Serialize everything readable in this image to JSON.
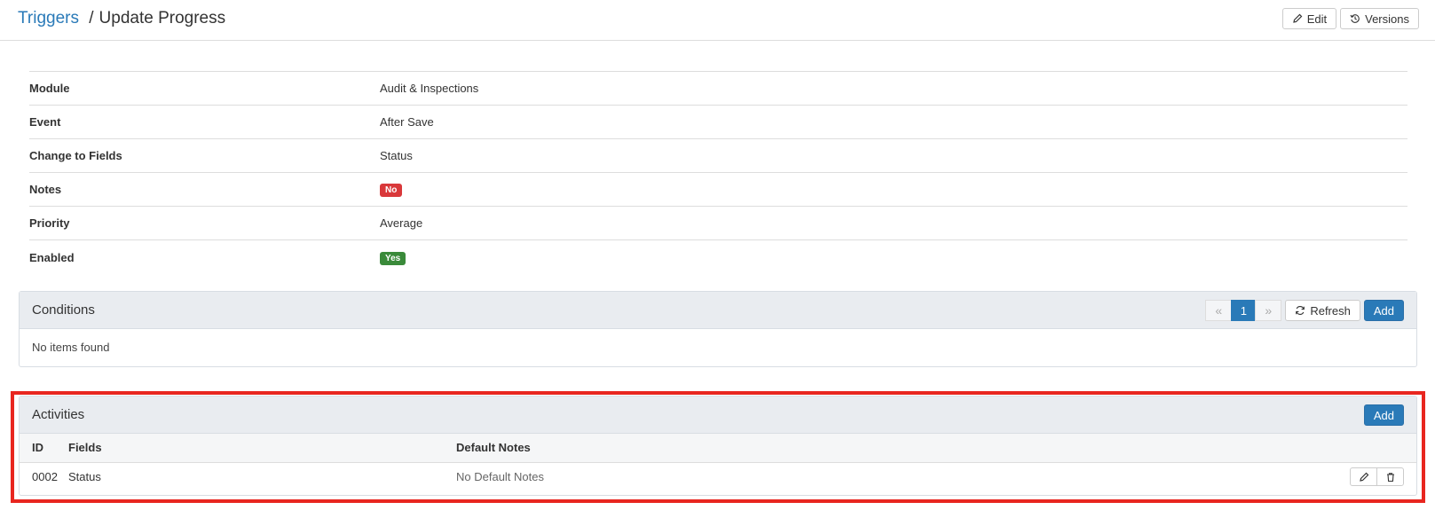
{
  "header": {
    "breadcrumb_link": "Triggers",
    "breadcrumb_separator": "/",
    "title": "Update Progress",
    "edit_label": "Edit",
    "versions_label": "Versions"
  },
  "details": [
    {
      "label": "Module",
      "value": "Audit & Inspections"
    },
    {
      "label": "Event",
      "value": "After Save"
    },
    {
      "label": "Change to Fields",
      "value": "Status"
    },
    {
      "label": "Notes",
      "badge": "No",
      "badge_color": "#d9383a"
    },
    {
      "label": "Priority",
      "value": "Average"
    },
    {
      "label": "Enabled",
      "badge": "Yes",
      "badge_color": "#3a8a3a"
    }
  ],
  "conditions": {
    "title": "Conditions",
    "pager": {
      "prev": "«",
      "page": "1",
      "next": "»"
    },
    "refresh_label": "Refresh",
    "add_label": "Add",
    "empty_text": "No items found"
  },
  "activities": {
    "title": "Activities",
    "add_label": "Add",
    "columns": [
      "ID",
      "Fields",
      "Default Notes"
    ],
    "rows": [
      {
        "id": "0002",
        "fields": "Status",
        "default_notes": "No Default Notes"
      }
    ]
  },
  "colors": {
    "accent": "#2a7ab8",
    "highlight_border": "#e8261f"
  },
  "icons": {
    "edit": "pencil-icon",
    "versions": "history-icon",
    "refresh": "refresh-icon",
    "delete": "trash-icon"
  }
}
